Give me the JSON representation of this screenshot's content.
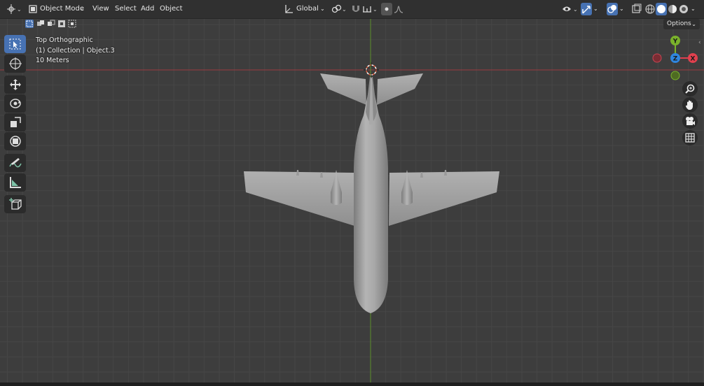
{
  "header": {
    "editor_type_icon": "3d-viewport-icon",
    "mode_label": "Object Mode",
    "menus": [
      "View",
      "Select",
      "Add",
      "Object"
    ],
    "transform_orientation": "Global",
    "options_label": "Options"
  },
  "overlay": {
    "view_name": "Top Orthographic",
    "collection_info": "(1) Collection | Object.3",
    "scale_info": "10 Meters"
  },
  "gizmo": {
    "y_label": "Y",
    "z_label": "Z",
    "x_label": "X",
    "x_color": "#e1404e",
    "y_color": "#7ab22b",
    "z_color": "#2f86e0"
  },
  "toolbar": {
    "tools": [
      "select-box-icon",
      "cursor-icon",
      "move-icon",
      "rotate-icon",
      "scale-icon",
      "transform-icon",
      "annotate-icon",
      "measure-icon",
      "add-cube-icon"
    ]
  },
  "nav_buttons": [
    "zoom-icon",
    "pan-hand-icon",
    "camera-icon",
    "ortho-grid-icon"
  ],
  "colors": {
    "viewport_bg": "#3d3d3d",
    "x_axis": "#9c3a40",
    "y_axis": "#5c8f2c",
    "active_blue": "#4772b3"
  }
}
